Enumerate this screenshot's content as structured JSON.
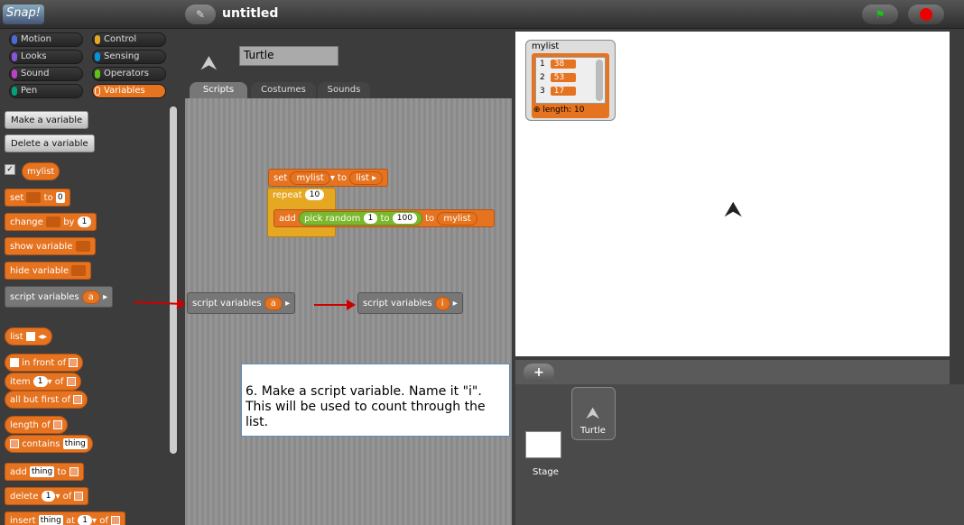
{
  "app": {
    "logo": "Snap!",
    "project_title": "untitled",
    "file_icon": "✎"
  },
  "categories": [
    {
      "label": "Motion",
      "color": "#4a6cd4"
    },
    {
      "label": "Control",
      "color": "#e6a822"
    },
    {
      "label": "Looks",
      "color": "#8a55d7"
    },
    {
      "label": "Sensing",
      "color": "#0494dc"
    },
    {
      "label": "Sound",
      "color": "#bb42c3"
    },
    {
      "label": "Operators",
      "color": "#62c213"
    },
    {
      "label": "Pen",
      "color": "#00a178"
    },
    {
      "label": "Variables",
      "color": "#f3761d"
    }
  ],
  "palette": {
    "make_variable": "Make a variable",
    "delete_variable": "Delete a variable",
    "mylist": "mylist",
    "set": "set",
    "to": "to",
    "set_value": "0",
    "change": "change",
    "by": "by",
    "change_value": "1",
    "show_variable": "show variable",
    "hide_variable": "hide variable",
    "script_variables": "script variables",
    "a": "a",
    "list": "list",
    "in_front_of": "in front of",
    "item": "item",
    "of": "of",
    "item_value": "1",
    "all_but_first_of": "all but first of",
    "length_of": "length of",
    "contains": "contains",
    "thing": "thing",
    "add": "add",
    "delete": "delete",
    "delete_value": "1",
    "insert": "insert",
    "at": "at",
    "insert_value": "1"
  },
  "sprite": {
    "name": "Turtle"
  },
  "tabs": [
    "Scripts",
    "Costumes",
    "Sounds"
  ],
  "script": {
    "set": "set",
    "var": "mylist",
    "to": "to",
    "list": "list",
    "repeat": "repeat",
    "repeat_count": "10",
    "add": "add",
    "pick_random": "pick random",
    "from": "1",
    "to2": "to",
    "max": "100",
    "to3": "to",
    "target": "mylist",
    "sv1_label": "script variables",
    "sv1_var": "a",
    "sv2_label": "script variables",
    "sv2_var": "i"
  },
  "watcher": {
    "label": "mylist",
    "items": [
      {
        "index": "1",
        "value": "38"
      },
      {
        "index": "2",
        "value": "53"
      },
      {
        "index": "3",
        "value": "17"
      }
    ],
    "length": "length: 10"
  },
  "corral": {
    "stage_label": "Stage",
    "sprite_label": "Turtle",
    "add_icon": "+"
  },
  "callout": {
    "line1": "6.  Make a script variable.  Name it \"i\".",
    "line2": "This will be used to count through the list."
  },
  "colors": {
    "variables": "#e5731f",
    "accent_arrow": "#cc0000"
  }
}
